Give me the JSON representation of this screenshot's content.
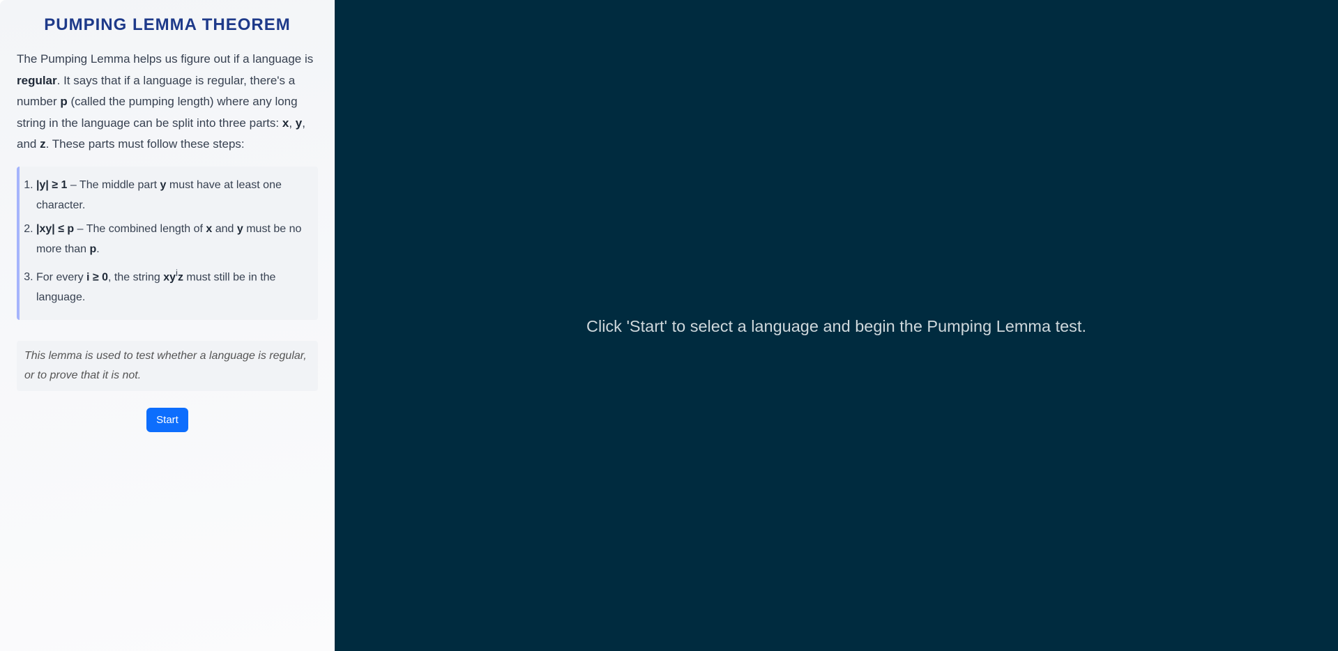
{
  "sidebar": {
    "title": "PUMPING LEMMA THEOREM",
    "intro": {
      "t1": "The Pumping Lemma helps us figure out if a language is ",
      "b1": "regular",
      "t2": ". It says that if a language is regular, there's a number ",
      "b2": "p",
      "t3": " (called the pumping length) where any long string in the language can be split into three parts: ",
      "b3": "x",
      "t4": ", ",
      "b4": "y",
      "t5": ", and ",
      "b5": "z",
      "t6": ". These parts must follow these steps:"
    },
    "steps": [
      {
        "b1": "|y| ≥ 1",
        "t1": " – The middle part ",
        "b2": "y",
        "t2": " must have at least one character."
      },
      {
        "b1": "|xy| ≤ p",
        "t1": " – The combined length of ",
        "b2": "x",
        "t2": " and ",
        "b3": "y",
        "t3": " must be no more than ",
        "b4": "p",
        "t4": "."
      },
      {
        "t1": "For every ",
        "b1": "i ≥ 0",
        "t2": ", the string ",
        "b2": "xy",
        "sup": "i",
        "b3": "z",
        "t3": " must still be in the language."
      }
    ],
    "note": "This lemma is used to test whether a language is regular, or to prove that it is not.",
    "start_label": "Start"
  },
  "main": {
    "prompt": "Click 'Start' to select a language and begin the Pumping Lemma test."
  },
  "colors": {
    "title": "#1e3a8a",
    "button": "#0d6efd",
    "main_bg": "#002b3f",
    "accent_border": "#a5b4fc"
  }
}
